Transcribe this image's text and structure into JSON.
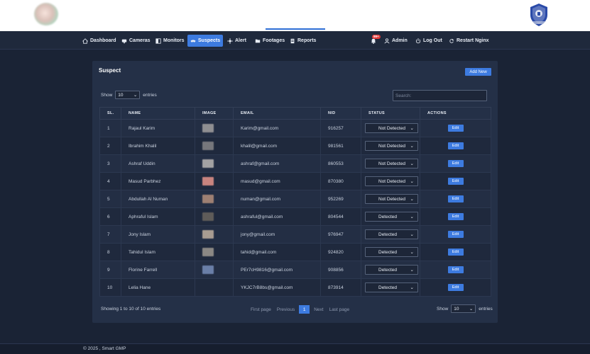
{
  "nav": {
    "items": [
      {
        "label": "Dashboard",
        "icon": "home-icon"
      },
      {
        "label": "Cameras",
        "icon": "camera-icon"
      },
      {
        "label": "Monitors",
        "icon": "monitor-icon"
      },
      {
        "label": "Suspects",
        "icon": "mask-icon",
        "active": true
      },
      {
        "label": "Alert",
        "icon": "alert-icon"
      },
      {
        "label": "Footages",
        "icon": "folder-icon"
      },
      {
        "label": "Reports",
        "icon": "report-icon"
      }
    ],
    "notification_count": "99+",
    "user_label": "Admin",
    "logout_label": "Log Out",
    "restart_label": "Restart Nginx"
  },
  "card": {
    "title": "Suspect",
    "add_button": "Add New"
  },
  "table_controls": {
    "show_label": "Show",
    "entries_value": "10",
    "entries_label": "entries",
    "search_placeholder": "Search:"
  },
  "table": {
    "columns": [
      "SL.",
      "NAME",
      "IMAGE",
      "EMAIL",
      "NID",
      "STATUS",
      "ACTIONS"
    ],
    "rows": [
      {
        "sl": "1",
        "name": "Rajaul Karim",
        "email": "Karim@gmail.com",
        "nid": "916257",
        "status": "Not Detected",
        "thumb": "#8f8f92"
      },
      {
        "sl": "2",
        "name": "Ibrahim Khalil",
        "email": "khalil@gmail.com",
        "nid": "981561",
        "status": "Not Detected",
        "thumb": "#76777c"
      },
      {
        "sl": "3",
        "name": "Ashraf Uddin",
        "email": "ashraf@gmail.com",
        "nid": "860553",
        "status": "Not Detected",
        "thumb": "#a3a2a3"
      },
      {
        "sl": "4",
        "name": "Masud Parbhez",
        "email": "masud@gmail.com",
        "nid": "870380",
        "status": "Not Detected",
        "thumb": "#c8847f"
      },
      {
        "sl": "5",
        "name": "Abdullah Al Numan",
        "email": "numan@gmail.com",
        "nid": "952269",
        "status": "Not Detected",
        "thumb": "#9e8073"
      },
      {
        "sl": "6",
        "name": "Aphraful Islam",
        "email": "ashraful@gmail.com",
        "nid": "804544",
        "status": "Detected",
        "thumb": "#5f5c59"
      },
      {
        "sl": "7",
        "name": "Jony Islam",
        "email": "jony@gmail.com",
        "nid": "976947",
        "status": "Detected",
        "thumb": "#a89c91"
      },
      {
        "sl": "8",
        "name": "Tahidul Islam",
        "email": "tahid@gmail.com",
        "nid": "924820",
        "status": "Detected",
        "thumb": "#8b8884"
      },
      {
        "sl": "9",
        "name": "Florine Farrell",
        "email": "PEr7cH9816@gmail.com",
        "nid": "908856",
        "status": "Detected",
        "thumb": "#6a7fa8"
      },
      {
        "sl": "10",
        "name": "Lelia Hane",
        "email": "YKJC7rB8bs@gmail.com",
        "nid": "873914",
        "status": "Detected",
        "thumb": ""
      }
    ],
    "edit_label": "Edit"
  },
  "pagination": {
    "info": "Showing 1 to 10 of 10 entries",
    "first": "First page",
    "previous": "Previous",
    "current": "1",
    "next": "Next",
    "last": "Last page"
  },
  "footer": {
    "text": "© 2025 , Smart GMP"
  },
  "colors": {
    "accent": "#3d7be0",
    "background": "#1a2335",
    "card": "#243047"
  }
}
